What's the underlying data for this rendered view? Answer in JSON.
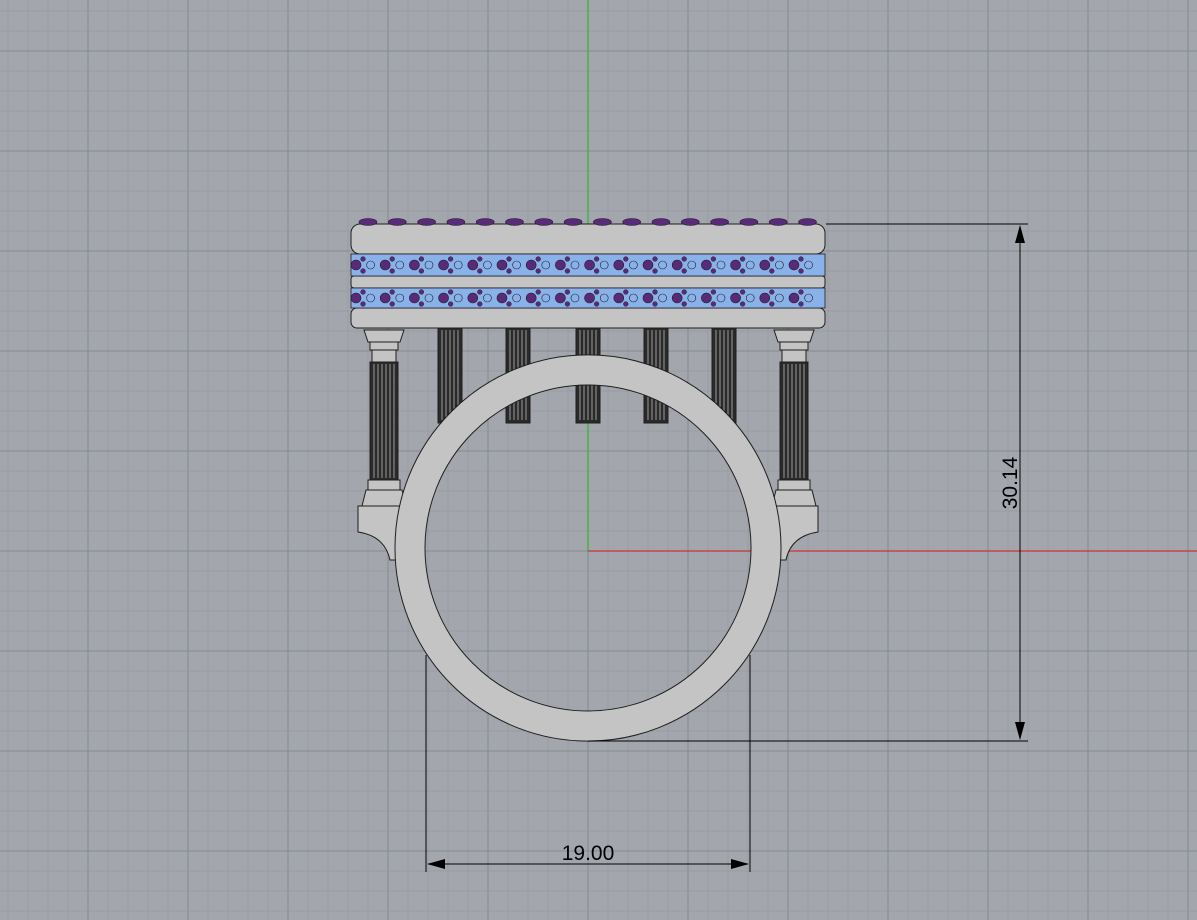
{
  "viewport": {
    "background": "#a3a7ad",
    "grid_minor_color": "#969aa1",
    "grid_major_color": "#868a91",
    "axis_x_color": "#c83232",
    "axis_y_color": "#32b432"
  },
  "model": {
    "metal_color": "#c4c4c4",
    "metal_shade": "#a9a9a9",
    "outline_color": "#1e1e1e",
    "gem_primary_color": "#8ab2ea",
    "gem_secondary_color": "#5a2a7a",
    "column_color": "#2a2a2a"
  },
  "dimensions": {
    "height_value": "30.14",
    "width_value": "19.00",
    "line_color": "#000000"
  }
}
